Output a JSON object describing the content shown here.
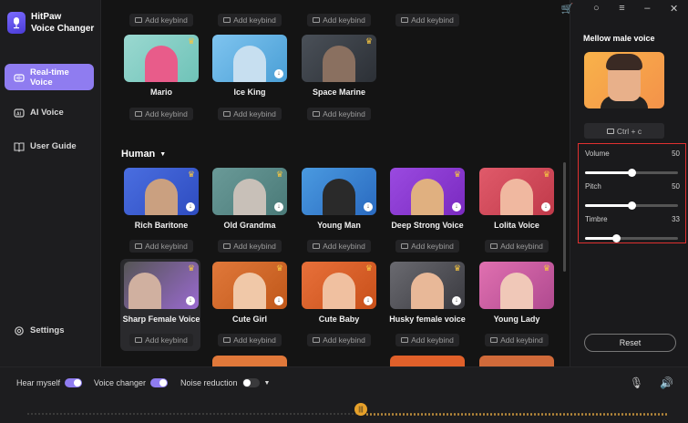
{
  "brand": {
    "name_line1": "HitPaw",
    "name_line2": "Voice Changer"
  },
  "sidebar": {
    "items": [
      {
        "label": "Real-time Voice",
        "icon": "waveform-icon",
        "active": true
      },
      {
        "label": "AI Voice",
        "icon": "ai-icon",
        "active": false
      },
      {
        "label": "User Guide",
        "icon": "book-icon",
        "active": false
      }
    ],
    "settings_label": "Settings"
  },
  "top_row_keybinds": [
    "Add keybind",
    "Add keybind",
    "Add keybind",
    "Add keybind"
  ],
  "row1": [
    {
      "name": "Mario",
      "keybind": "Add keybind"
    },
    {
      "name": "Ice King",
      "keybind": "Add keybind"
    },
    {
      "name": "Space Marine",
      "keybind": "Add keybind"
    }
  ],
  "section": {
    "title": "Human"
  },
  "row2": [
    {
      "name": "Rich Baritone",
      "keybind": "Add keybind"
    },
    {
      "name": "Old Grandma",
      "keybind": "Add keybind"
    },
    {
      "name": "Young Man",
      "keybind": "Add keybind"
    },
    {
      "name": "Deep Strong Voice",
      "keybind": "Add keybind"
    },
    {
      "name": "Lolita Voice",
      "keybind": "Add keybind"
    }
  ],
  "row3": [
    {
      "name": "Sharp Female Voice",
      "keybind": "Add keybind"
    },
    {
      "name": "Cute Girl",
      "keybind": "Add keybind"
    },
    {
      "name": "Cute Baby",
      "keybind": "Add keybind"
    },
    {
      "name": "Husky female voice",
      "keybind": "Add keybind"
    },
    {
      "name": "Young Lady",
      "keybind": "Add keybind"
    }
  ],
  "panel": {
    "title": "Mellow male voice",
    "shortcut": "Ctrl + c",
    "sliders": [
      {
        "label": "Volume",
        "value": "50",
        "fraction": 0.5
      },
      {
        "label": "Pitch",
        "value": "50",
        "fraction": 0.5
      },
      {
        "label": "Timbre",
        "value": "33",
        "fraction": 0.33
      }
    ],
    "reset_label": "Reset"
  },
  "bottom": {
    "hear_myself": "Hear myself",
    "voice_changer": "Voice changer",
    "noise_reduction": "Noise reduction"
  },
  "colors": {
    "accent": "#8f7cf0",
    "crown": "#f5c542",
    "highlight": "#e03030"
  }
}
